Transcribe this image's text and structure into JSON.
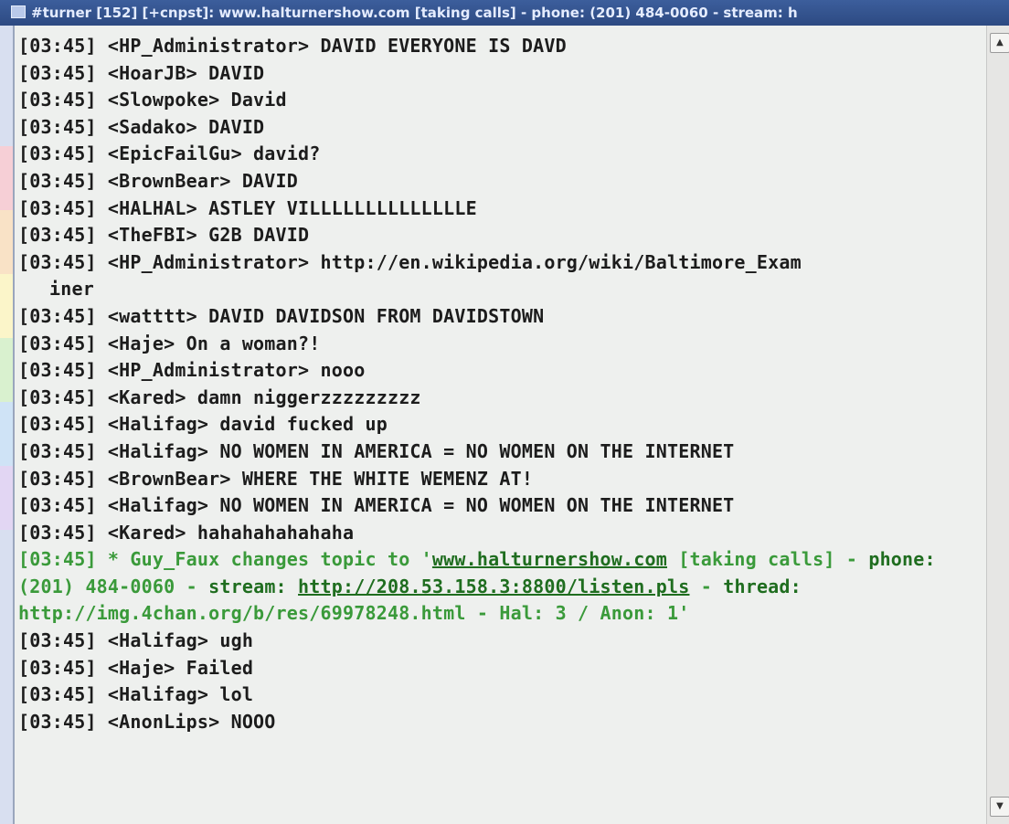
{
  "window": {
    "title": "#turner [152] [+cnpst]: www.halturnershow.com [taking calls] - phone: (201) 484-0060 - stream: h",
    "accent_color": "#2d4a82",
    "topic_color": "#3a9a3a",
    "text_color": "#1c1c1c"
  },
  "chat": {
    "lines_before_topic": [
      "[03:45] <HP_Administrator> DAVID EVERYONE IS DAVD",
      "[03:45] <HoarJB> DAVID",
      "[03:45] <Slowpoke> David",
      "[03:45] <Sadako> DAVID",
      "[03:45] <EpicFailGu> david?",
      "[03:45] <BrownBear> DAVID",
      "[03:45] <HALHAL> ASTLEY VILLLLLLLLLLLLLLE",
      "[03:45] <TheFBI> G2B DAVID",
      "[03:45] <HP_Administrator> http://en.wikipedia.org/wiki/Baltimore_Exam",
      "iner",
      "[03:45] <watttt> DAVID DAVIDSON FROM DAVIDSTOWN",
      "[03:45] <Haje> On a woman?!",
      "[03:45] <HP_Administrator> nooo",
      "[03:45] <Kared> damn niggerzzzzzzzzz",
      "[03:45] <Halifag> david fucked up",
      "[03:45] <Halifag> NO WOMEN IN AMERICA = NO WOMEN ON THE INTERNET",
      "[03:45] <BrownBear> WHERE THE WHITE WEMENZ AT!",
      "[03:45] <Halifag> NO WOMEN IN AMERICA = NO WOMEN ON THE INTERNET",
      "[03:45] <Kared> hahahahahahaha"
    ],
    "topic": {
      "prefix": "[03:45] * Guy_Faux changes topic to '",
      "site_link": "www.halturnershow.com",
      "taking_calls": " [taking calls] - ",
      "phone_key": "phone:",
      "phone_value": " (201) 484-0060 - ",
      "stream_key": "stream:",
      "space": " ",
      "stream_link": "http://208.53.158.3:8800/listen.pls",
      "sep": " - ",
      "thread_key": "thread:",
      "thread_value": " http://img.4chan.org/b/res/69978248.html - Hal: 3 / Anon: 1'"
    },
    "lines_after_topic": [
      "[03:45] <Halifag> ugh",
      "[03:45] <Haje> Failed",
      "[03:45] <Halifag> lol",
      "[03:45] <AnonLips> NOOO"
    ]
  },
  "scrollbar": {
    "up_icon": "scroll-up-arrow",
    "down_icon": "scroll-down-arrow",
    "up_glyph": "▲",
    "down_glyph": "▼"
  }
}
